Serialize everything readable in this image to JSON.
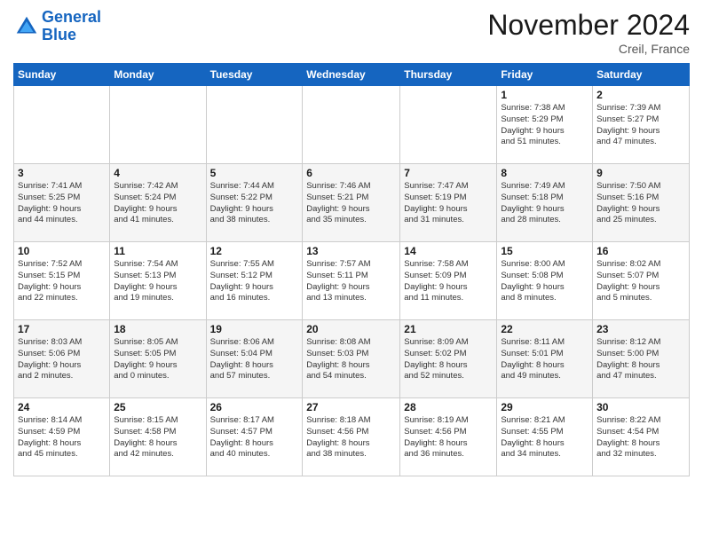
{
  "header": {
    "logo_line1": "General",
    "logo_line2": "Blue",
    "month": "November 2024",
    "location": "Creil, France"
  },
  "weekdays": [
    "Sunday",
    "Monday",
    "Tuesday",
    "Wednesday",
    "Thursday",
    "Friday",
    "Saturday"
  ],
  "weeks": [
    [
      {
        "day": "",
        "info": ""
      },
      {
        "day": "",
        "info": ""
      },
      {
        "day": "",
        "info": ""
      },
      {
        "day": "",
        "info": ""
      },
      {
        "day": "",
        "info": ""
      },
      {
        "day": "1",
        "info": "Sunrise: 7:38 AM\nSunset: 5:29 PM\nDaylight: 9 hours\nand 51 minutes."
      },
      {
        "day": "2",
        "info": "Sunrise: 7:39 AM\nSunset: 5:27 PM\nDaylight: 9 hours\nand 47 minutes."
      }
    ],
    [
      {
        "day": "3",
        "info": "Sunrise: 7:41 AM\nSunset: 5:25 PM\nDaylight: 9 hours\nand 44 minutes."
      },
      {
        "day": "4",
        "info": "Sunrise: 7:42 AM\nSunset: 5:24 PM\nDaylight: 9 hours\nand 41 minutes."
      },
      {
        "day": "5",
        "info": "Sunrise: 7:44 AM\nSunset: 5:22 PM\nDaylight: 9 hours\nand 38 minutes."
      },
      {
        "day": "6",
        "info": "Sunrise: 7:46 AM\nSunset: 5:21 PM\nDaylight: 9 hours\nand 35 minutes."
      },
      {
        "day": "7",
        "info": "Sunrise: 7:47 AM\nSunset: 5:19 PM\nDaylight: 9 hours\nand 31 minutes."
      },
      {
        "day": "8",
        "info": "Sunrise: 7:49 AM\nSunset: 5:18 PM\nDaylight: 9 hours\nand 28 minutes."
      },
      {
        "day": "9",
        "info": "Sunrise: 7:50 AM\nSunset: 5:16 PM\nDaylight: 9 hours\nand 25 minutes."
      }
    ],
    [
      {
        "day": "10",
        "info": "Sunrise: 7:52 AM\nSunset: 5:15 PM\nDaylight: 9 hours\nand 22 minutes."
      },
      {
        "day": "11",
        "info": "Sunrise: 7:54 AM\nSunset: 5:13 PM\nDaylight: 9 hours\nand 19 minutes."
      },
      {
        "day": "12",
        "info": "Sunrise: 7:55 AM\nSunset: 5:12 PM\nDaylight: 9 hours\nand 16 minutes."
      },
      {
        "day": "13",
        "info": "Sunrise: 7:57 AM\nSunset: 5:11 PM\nDaylight: 9 hours\nand 13 minutes."
      },
      {
        "day": "14",
        "info": "Sunrise: 7:58 AM\nSunset: 5:09 PM\nDaylight: 9 hours\nand 11 minutes."
      },
      {
        "day": "15",
        "info": "Sunrise: 8:00 AM\nSunset: 5:08 PM\nDaylight: 9 hours\nand 8 minutes."
      },
      {
        "day": "16",
        "info": "Sunrise: 8:02 AM\nSunset: 5:07 PM\nDaylight: 9 hours\nand 5 minutes."
      }
    ],
    [
      {
        "day": "17",
        "info": "Sunrise: 8:03 AM\nSunset: 5:06 PM\nDaylight: 9 hours\nand 2 minutes."
      },
      {
        "day": "18",
        "info": "Sunrise: 8:05 AM\nSunset: 5:05 PM\nDaylight: 9 hours\nand 0 minutes."
      },
      {
        "day": "19",
        "info": "Sunrise: 8:06 AM\nSunset: 5:04 PM\nDaylight: 8 hours\nand 57 minutes."
      },
      {
        "day": "20",
        "info": "Sunrise: 8:08 AM\nSunset: 5:03 PM\nDaylight: 8 hours\nand 54 minutes."
      },
      {
        "day": "21",
        "info": "Sunrise: 8:09 AM\nSunset: 5:02 PM\nDaylight: 8 hours\nand 52 minutes."
      },
      {
        "day": "22",
        "info": "Sunrise: 8:11 AM\nSunset: 5:01 PM\nDaylight: 8 hours\nand 49 minutes."
      },
      {
        "day": "23",
        "info": "Sunrise: 8:12 AM\nSunset: 5:00 PM\nDaylight: 8 hours\nand 47 minutes."
      }
    ],
    [
      {
        "day": "24",
        "info": "Sunrise: 8:14 AM\nSunset: 4:59 PM\nDaylight: 8 hours\nand 45 minutes."
      },
      {
        "day": "25",
        "info": "Sunrise: 8:15 AM\nSunset: 4:58 PM\nDaylight: 8 hours\nand 42 minutes."
      },
      {
        "day": "26",
        "info": "Sunrise: 8:17 AM\nSunset: 4:57 PM\nDaylight: 8 hours\nand 40 minutes."
      },
      {
        "day": "27",
        "info": "Sunrise: 8:18 AM\nSunset: 4:56 PM\nDaylight: 8 hours\nand 38 minutes."
      },
      {
        "day": "28",
        "info": "Sunrise: 8:19 AM\nSunset: 4:56 PM\nDaylight: 8 hours\nand 36 minutes."
      },
      {
        "day": "29",
        "info": "Sunrise: 8:21 AM\nSunset: 4:55 PM\nDaylight: 8 hours\nand 34 minutes."
      },
      {
        "day": "30",
        "info": "Sunrise: 8:22 AM\nSunset: 4:54 PM\nDaylight: 8 hours\nand 32 minutes."
      }
    ]
  ]
}
